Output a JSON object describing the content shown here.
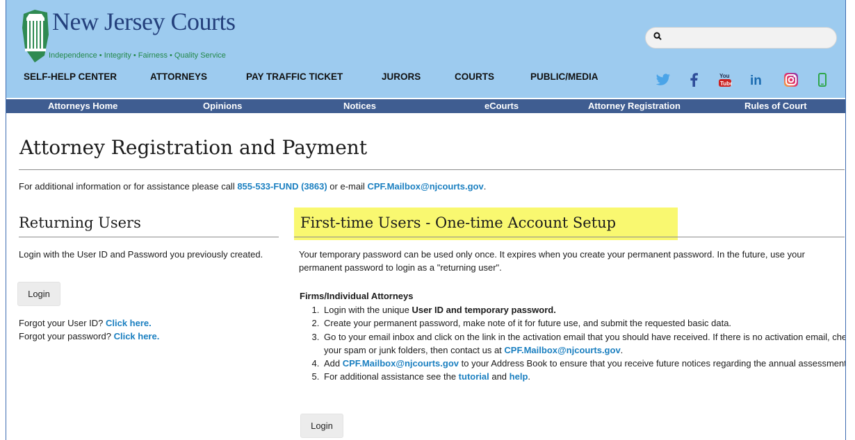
{
  "header": {
    "logo_title": "New Jersey Courts",
    "logo_tagline": "Independence • Integrity • Fairness • Quality Service",
    "search_placeholder": "",
    "main_nav": [
      "SELF-HELP CENTER",
      "ATTORNEYS",
      "PAY TRAFFIC TICKET",
      "JURORS",
      "COURTS",
      "PUBLIC/MEDIA"
    ],
    "social_icons": [
      "twitter-icon",
      "facebook-icon",
      "youtube-icon",
      "linkedin-icon",
      "instagram-icon",
      "mobile-icon"
    ],
    "colors": {
      "header_bg": "#9dcbef",
      "subnav_bg": "#3f5d91",
      "link": "#1a7fc0"
    }
  },
  "sub_nav": [
    "Attorneys Home",
    "Opinions",
    "Notices",
    "eCourts",
    "Attorney Registration",
    "Rules of Court"
  ],
  "page": {
    "title": "Attorney Registration and Payment",
    "info_prefix": "For additional information or for assistance please call ",
    "info_phone": "855-533-FUND (3863)",
    "info_mid": " or e-mail ",
    "info_email": "CPF.Mailbox@njcourts.gov",
    "info_suffix": "."
  },
  "returning": {
    "heading": "Returning Users",
    "text": "Login with the User ID and Password you previously created.",
    "login_label": "Login",
    "forgot_user_prefix": "Forgot your User ID? ",
    "forgot_password_prefix": "Forgot your password? ",
    "click_here": "Click here."
  },
  "first_time": {
    "heading": "First-time Users - One-time Account Setup",
    "intro": "Your temporary password can be used only once. It expires when you create your permanent password. In the future, use your permanent password to login as a \"returning user\".",
    "subheading": "Firms/Individual Attorneys",
    "step1_prefix": "Login with the unique ",
    "step1_bold": "User ID and temporary password.",
    "step2": "Create your permanent password, make note of it for future use, and submit the requested basic data.",
    "step3_text": "Go to your email inbox and click on the link in the activation email that you should have received. If there is no activation email, check your spam or junk folders, then contact us at ",
    "step3_email": "CPF.Mailbox@njcourts.gov",
    "step3_suffix": ".",
    "step4_prefix": "Add ",
    "step4_email": "CPF.Mailbox@njcourts.gov",
    "step4_suffix": " to your Address Book to ensure that you receive future notices regarding the annual assessment.",
    "step5_prefix": "For additional assistance see the ",
    "step5_tutorial": "tutorial",
    "step5_and": " and ",
    "step5_help": "help",
    "step5_suffix": ".",
    "login_label": "Login"
  }
}
